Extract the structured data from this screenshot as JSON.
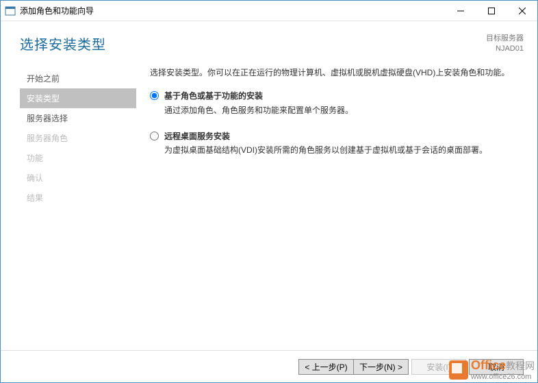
{
  "window": {
    "title": "添加角色和功能向导"
  },
  "header": {
    "page_title": "选择安装类型",
    "target_label": "目标服务器",
    "target_value": "NJAD01"
  },
  "sidebar": {
    "items": [
      {
        "label": "开始之前",
        "state": "normal"
      },
      {
        "label": "安装类型",
        "state": "active"
      },
      {
        "label": "服务器选择",
        "state": "normal"
      },
      {
        "label": "服务器角色",
        "state": "disabled"
      },
      {
        "label": "功能",
        "state": "disabled"
      },
      {
        "label": "确认",
        "state": "disabled"
      },
      {
        "label": "结果",
        "state": "disabled"
      }
    ]
  },
  "main": {
    "intro": "选择安装类型。你可以在正在运行的物理计算机、虚拟机或脱机虚拟硬盘(VHD)上安装角色和功能。",
    "options": [
      {
        "title": "基于角色或基于功能的安装",
        "desc": "通过添加角色、角色服务和功能来配置单个服务器。",
        "checked": true
      },
      {
        "title": "远程桌面服务安装",
        "desc": "为虚拟桌面基础结构(VDI)安装所需的角色服务以创建基于虚拟机或基于会话的桌面部署。",
        "checked": false
      }
    ]
  },
  "footer": {
    "prev": "< 上一步(P)",
    "next": "下一步(N) >",
    "install": "安装(I)",
    "cancel": "取消"
  },
  "watermark": {
    "brand": "Office",
    "brand2": "教程网",
    "url": "www.office26.com"
  }
}
